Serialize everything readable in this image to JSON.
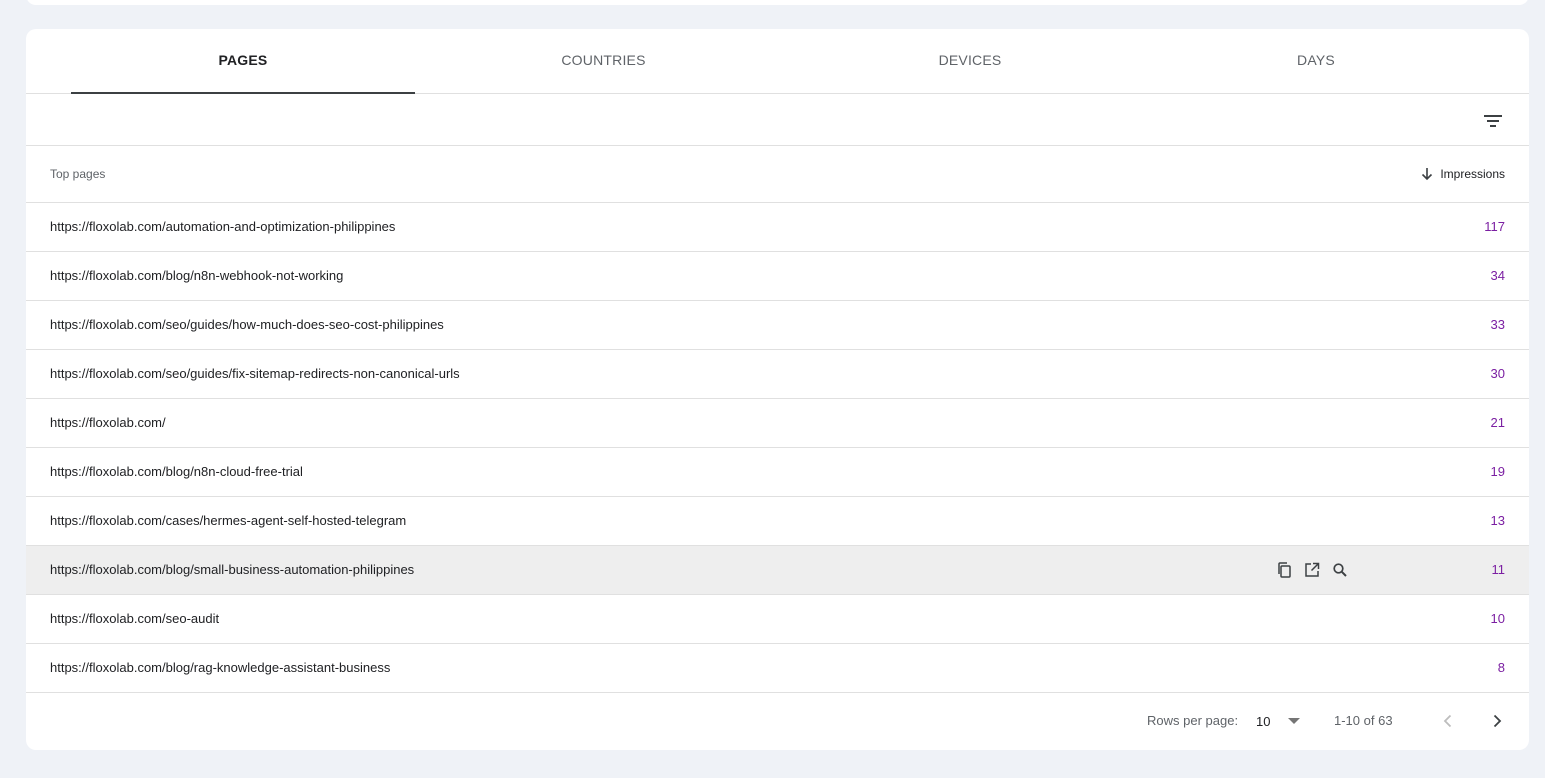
{
  "tabs": [
    {
      "label": "PAGES",
      "active": true
    },
    {
      "label": "COUNTRIES",
      "active": false
    },
    {
      "label": "DEVICES",
      "active": false
    },
    {
      "label": "DAYS",
      "active": false
    }
  ],
  "toolbar": {
    "filter_icon": "filter-icon"
  },
  "table": {
    "header_label": "Top pages",
    "metric_label": "Impressions",
    "sort_icon": "arrow-down-icon",
    "rows": [
      {
        "url": "https://floxolab.com/automation-and-optimization-philippines",
        "impressions": "117"
      },
      {
        "url": "https://floxolab.com/blog/n8n-webhook-not-working",
        "impressions": "34"
      },
      {
        "url": "https://floxolab.com/seo/guides/how-much-does-seo-cost-philippines",
        "impressions": "33"
      },
      {
        "url": "https://floxolab.com/seo/guides/fix-sitemap-redirects-non-canonical-urls",
        "impressions": "30"
      },
      {
        "url": "https://floxolab.com/",
        "impressions": "21"
      },
      {
        "url": "https://floxolab.com/blog/n8n-cloud-free-trial",
        "impressions": "19"
      },
      {
        "url": "https://floxolab.com/cases/hermes-agent-self-hosted-telegram",
        "impressions": "13"
      },
      {
        "url": "https://floxolab.com/blog/small-business-automation-philippines",
        "impressions": "11"
      },
      {
        "url": "https://floxolab.com/seo-audit",
        "impressions": "10"
      },
      {
        "url": "https://floxolab.com/blog/rag-knowledge-assistant-business",
        "impressions": "8"
      }
    ],
    "row_action_icons": [
      "copy-icon",
      "open-in-new-icon",
      "search-icon"
    ]
  },
  "pagination": {
    "rows_per_page_label": "Rows per page:",
    "rows_per_page_value": "10",
    "range_label": "1-10 of 63"
  },
  "colors": {
    "page_background": "#eff2f7",
    "metric_value": "#7b1fa2",
    "hover_row": "#eeeeee"
  }
}
